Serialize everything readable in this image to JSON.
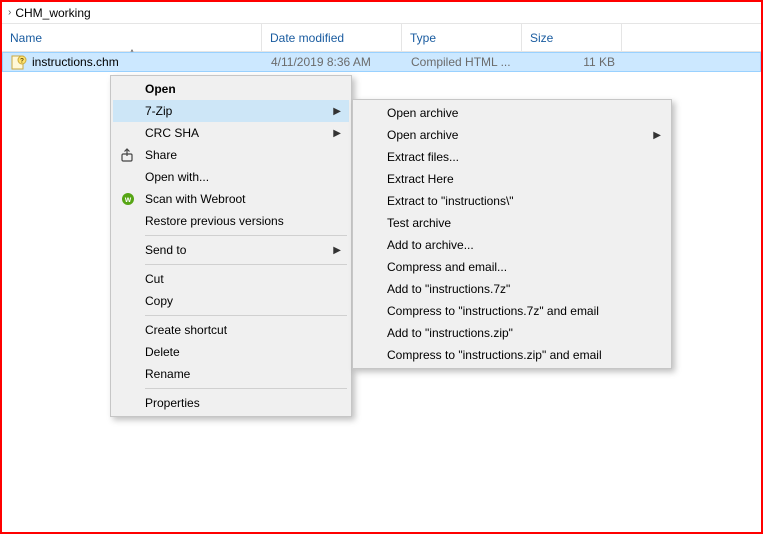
{
  "breadcrumb": {
    "folder": "CHM_working"
  },
  "columns": {
    "name": "Name",
    "date": "Date modified",
    "type": "Type",
    "size": "Size"
  },
  "file": {
    "name": "instructions.chm",
    "date": "4/11/2019 8:36 AM",
    "type": "Compiled HTML ...",
    "size": "11 KB"
  },
  "menu": {
    "open": "Open",
    "sevenzip": "7-Zip",
    "crcsha": "CRC SHA",
    "share": "Share",
    "openwith": "Open with...",
    "webroot": "Scan with Webroot",
    "restore": "Restore previous versions",
    "sendto": "Send to",
    "cut": "Cut",
    "copy": "Copy",
    "shortcut": "Create shortcut",
    "delete": "Delete",
    "rename": "Rename",
    "properties": "Properties"
  },
  "submenu": {
    "open1": "Open archive",
    "open2": "Open archive",
    "extractfiles": "Extract files...",
    "extracthere": "Extract Here",
    "extractto": "Extract to \"instructions\\\"",
    "test": "Test archive",
    "addto": "Add to archive...",
    "compressemail": "Compress and email...",
    "add7z": "Add to \"instructions.7z\"",
    "comp7z": "Compress to \"instructions.7z\" and email",
    "addzip": "Add to \"instructions.zip\"",
    "compzip": "Compress to \"instructions.zip\" and email"
  }
}
